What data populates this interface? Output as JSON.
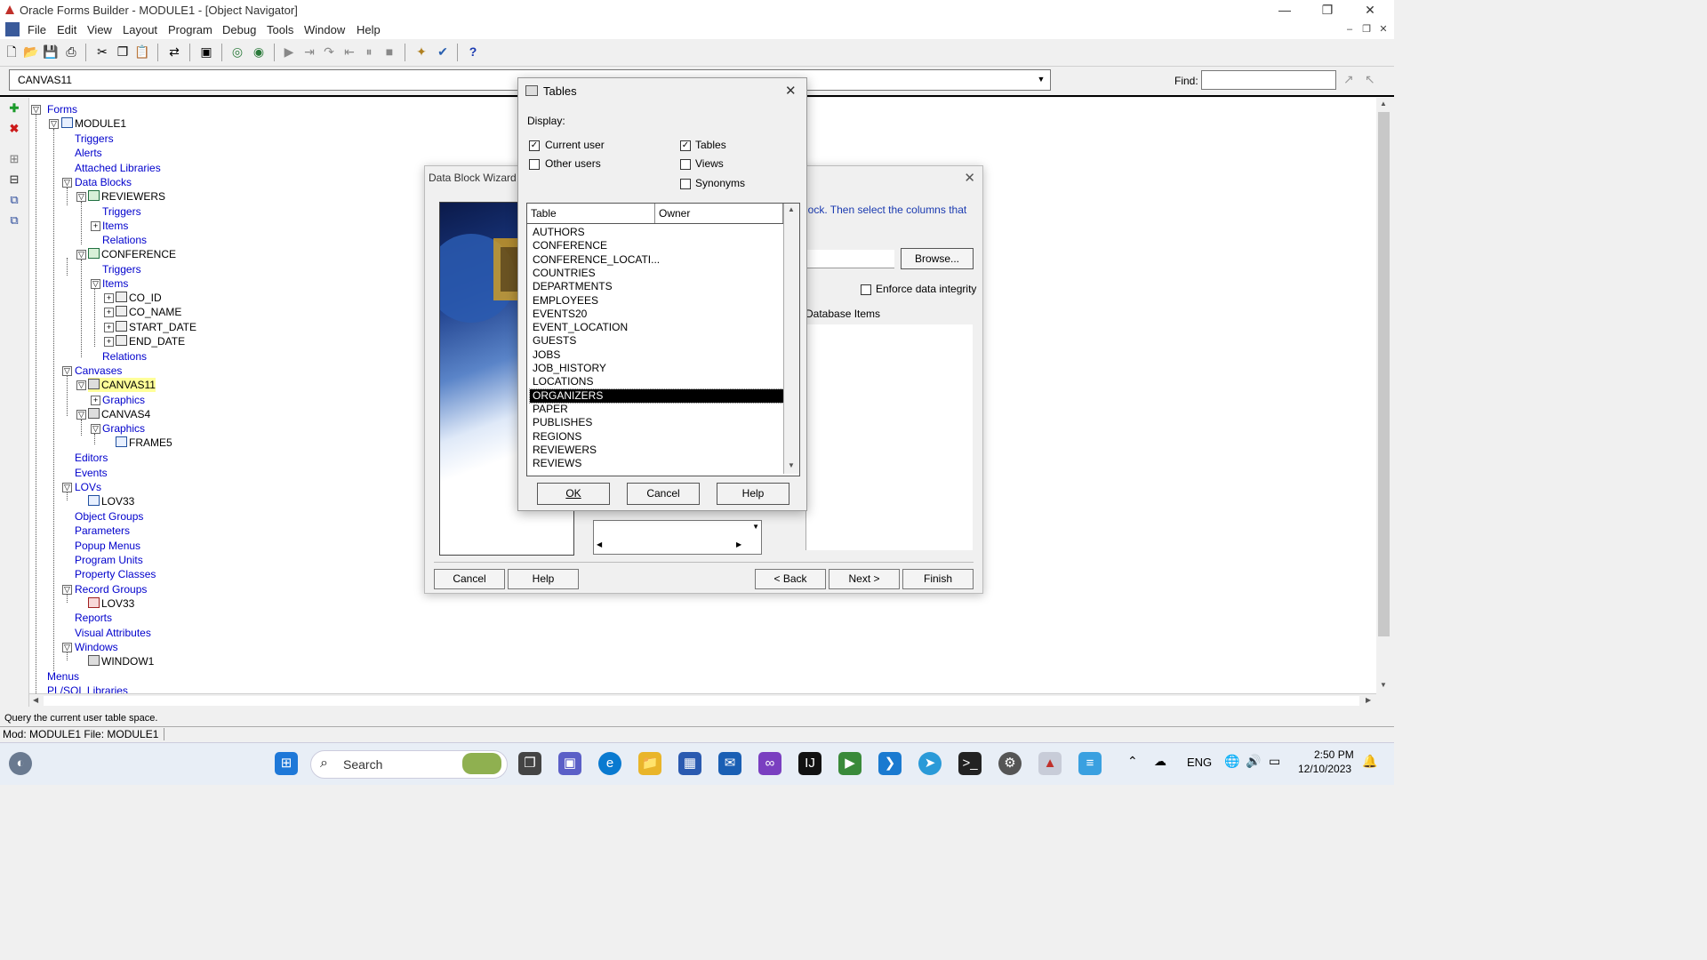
{
  "window": {
    "title": "Oracle Forms Builder - MODULE1 - [Object Navigator]"
  },
  "menu": [
    "File",
    "Edit",
    "View",
    "Layout",
    "Program",
    "Debug",
    "Tools",
    "Window",
    "Help"
  ],
  "objbar": {
    "selected": "CANVAS11",
    "find_label": "Find:",
    "find_value": ""
  },
  "tree": {
    "forms": "Forms",
    "module1": "MODULE1",
    "triggers": "Triggers",
    "alerts": "Alerts",
    "attached_libraries": "Attached Libraries",
    "data_blocks": "Data Blocks",
    "reviewers": "REVIEWERS",
    "rev_triggers": "Triggers",
    "rev_items": "Items",
    "rev_relations": "Relations",
    "conference": "CONFERENCE",
    "conf_triggers": "Triggers",
    "conf_items": "Items",
    "co_id": "CO_ID",
    "co_name": "CO_NAME",
    "start_date": "START_DATE",
    "end_date": "END_DATE",
    "conf_relations": "Relations",
    "canvases": "Canvases",
    "canvas11": "CANVAS11",
    "c11_graphics": "Graphics",
    "canvas4": "CANVAS4",
    "c4_graphics": "Graphics",
    "frame5": "FRAME5",
    "editors": "Editors",
    "events": "Events",
    "lovs": "LOVs",
    "lov33": "LOV33",
    "object_groups": "Object Groups",
    "parameters": "Parameters",
    "popup_menus": "Popup Menus",
    "program_units": "Program Units",
    "property_classes": "Property Classes",
    "record_groups": "Record Groups",
    "rg_lov33": "LOV33",
    "reports": "Reports",
    "visual_attributes": "Visual Attributes",
    "windows": "Windows",
    "window1": "WINDOW1",
    "menus": "Menus",
    "plsql_libraries": "PL/SQL Libraries"
  },
  "wizard": {
    "title": "Data Block Wizard",
    "instruction_fragment": "lock. Then select the columns that",
    "browse": "Browse...",
    "enforce_label": "Enforce data integrity",
    "database_items": "Database Items",
    "buttons": {
      "cancel": "Cancel",
      "help": "Help",
      "back": "< Back",
      "next": "Next >",
      "finish": "Finish"
    }
  },
  "tables_dialog": {
    "title": "Tables",
    "display_label": "Display:",
    "current_user": "Current user",
    "other_users": "Other users",
    "tables": "Tables",
    "views": "Views",
    "synonyms": "Synonyms",
    "col_table": "Table",
    "col_owner": "Owner",
    "rows": [
      "AUTHORS",
      "CONFERENCE",
      "CONFERENCE_LOCATI...",
      "COUNTRIES",
      "DEPARTMENTS",
      "EMPLOYEES",
      "EVENTS20",
      "EVENT_LOCATION",
      "GUESTS",
      "JOBS",
      "JOB_HISTORY",
      "LOCATIONS",
      "ORGANIZERS",
      "PAPER",
      "PUBLISHES",
      "REGIONS",
      "REVIEWERS",
      "REVIEWS"
    ],
    "selected_row": "ORGANIZERS",
    "ok": "OK",
    "cancel": "Cancel",
    "help": "Help"
  },
  "status": {
    "hint": "Query the current user table space.",
    "mod": "Mod: MODULE1 File: MODULE1"
  },
  "taskbar": {
    "search": "Search",
    "lang": "ENG",
    "time": "2:50 PM",
    "date": "12/10/2023"
  }
}
